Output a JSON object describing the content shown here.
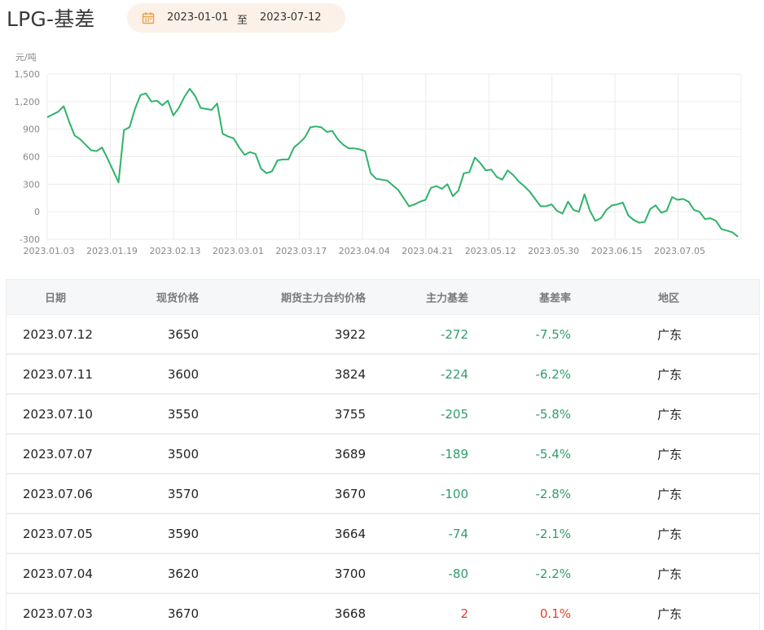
{
  "header": {
    "title": "LPG-基差",
    "date_start": "2023-01-01",
    "date_separator": "至",
    "date_end": "2023-07-12",
    "calendar_icon": "calendar-icon",
    "accent_color": "#e8a14a"
  },
  "chart_data": {
    "type": "line",
    "ylabel": "元/吨",
    "ylim": [
      -300,
      1500
    ],
    "yticks": [
      "1,500",
      "1,200",
      "900",
      "600",
      "300",
      "0",
      "-300"
    ],
    "xtick_labels": [
      "2023.01.03",
      "2023.01.19",
      "2023.02.13",
      "2023.03.01",
      "2023.03.17",
      "2023.04.04",
      "2023.04.21",
      "2023.05.12",
      "2023.05.30",
      "2023.06.15",
      "2023.07.05"
    ],
    "line_color": "#2fb36a",
    "grid": true,
    "series": [
      {
        "values": [
          1030,
          1060,
          1090,
          1150,
          980,
          830,
          790,
          730,
          670,
          660,
          700,
          580,
          450,
          320,
          890,
          920,
          1120,
          1270,
          1290,
          1200,
          1210,
          1160,
          1210,
          1050,
          1130,
          1250,
          1340,
          1260,
          1130,
          1120,
          1110,
          1180,
          850,
          820,
          800,
          700,
          620,
          650,
          630,
          470,
          420,
          440,
          560,
          570,
          570,
          700,
          750,
          810,
          920,
          930,
          920,
          870,
          880,
          790,
          730,
          690,
          690,
          680,
          660,
          420,
          360,
          350,
          340,
          290,
          240,
          150,
          60,
          80,
          110,
          130,
          260,
          280,
          250,
          300,
          170,
          230,
          420,
          430,
          590,
          530,
          450,
          460,
          380,
          350,
          450,
          400,
          330,
          280,
          220,
          140,
          60,
          60,
          80,
          10,
          -20,
          110,
          20,
          0,
          190,
          10,
          -100,
          -70,
          20,
          70,
          80,
          100,
          -40,
          -90,
          -120,
          -110,
          30,
          70,
          -10,
          10,
          160,
          130,
          140,
          110,
          20,
          0,
          -80,
          -70,
          -100,
          -189,
          -205,
          -224,
          -272
        ]
      }
    ]
  },
  "table": {
    "columns": [
      "日期",
      "现货价格",
      "期货主力合约价格",
      "主力基差",
      "基差率",
      "地区"
    ],
    "rows": [
      {
        "date": "2023.07.12",
        "spot": "3650",
        "futures": "3922",
        "basis": "-272",
        "rate": "-7.5%",
        "region": "广东",
        "tone": "green"
      },
      {
        "date": "2023.07.11",
        "spot": "3600",
        "futures": "3824",
        "basis": "-224",
        "rate": "-6.2%",
        "region": "广东",
        "tone": "green"
      },
      {
        "date": "2023.07.10",
        "spot": "3550",
        "futures": "3755",
        "basis": "-205",
        "rate": "-5.8%",
        "region": "广东",
        "tone": "green"
      },
      {
        "date": "2023.07.07",
        "spot": "3500",
        "futures": "3689",
        "basis": "-189",
        "rate": "-5.4%",
        "region": "广东",
        "tone": "green"
      },
      {
        "date": "2023.07.06",
        "spot": "3570",
        "futures": "3670",
        "basis": "-100",
        "rate": "-2.8%",
        "region": "广东",
        "tone": "green"
      },
      {
        "date": "2023.07.05",
        "spot": "3590",
        "futures": "3664",
        "basis": "-74",
        "rate": "-2.1%",
        "region": "广东",
        "tone": "green"
      },
      {
        "date": "2023.07.04",
        "spot": "3620",
        "futures": "3700",
        "basis": "-80",
        "rate": "-2.2%",
        "region": "广东",
        "tone": "green"
      },
      {
        "date": "2023.07.03",
        "spot": "3670",
        "futures": "3668",
        "basis": "2",
        "rate": "0.1%",
        "region": "广东",
        "tone": "red"
      }
    ]
  }
}
